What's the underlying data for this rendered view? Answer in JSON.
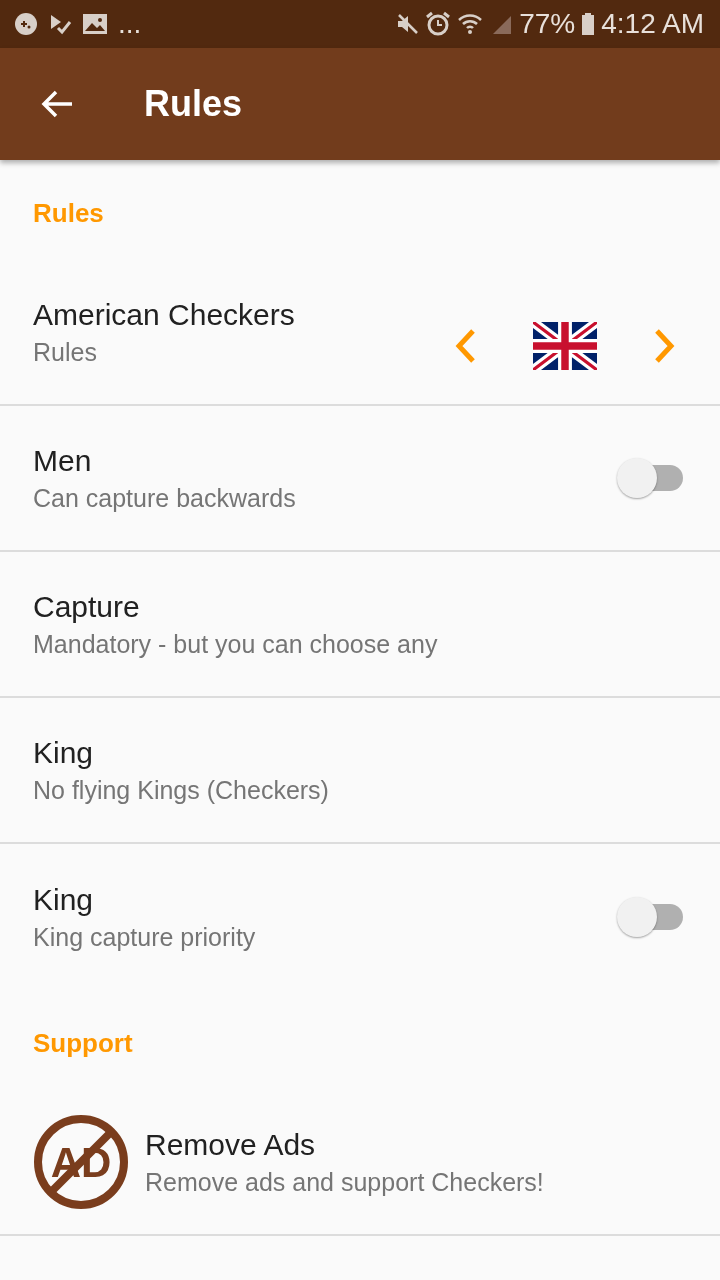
{
  "status_bar": {
    "overflow": "...",
    "battery": "77%",
    "time": "4:12 AM"
  },
  "app_bar": {
    "title": "Rules"
  },
  "sections": [
    {
      "header": "Rules",
      "items": [
        {
          "kind": "selector",
          "title": "American Checkers",
          "subtitle": "Rules"
        },
        {
          "kind": "switch",
          "title": "Men",
          "subtitle": "Can capture backwards",
          "on": false
        },
        {
          "kind": "text",
          "title": "Capture",
          "subtitle": "Mandatory - but you can choose any"
        },
        {
          "kind": "text",
          "title": "King",
          "subtitle": "No flying Kings (Checkers)"
        },
        {
          "kind": "switch",
          "title": "King",
          "subtitle": "King capture priority",
          "on": false
        }
      ]
    },
    {
      "header": "Support",
      "items": [
        {
          "kind": "icon",
          "title": "Remove Ads",
          "subtitle": "Remove ads and support Checkers!",
          "icon_text": "AD"
        }
      ]
    }
  ]
}
